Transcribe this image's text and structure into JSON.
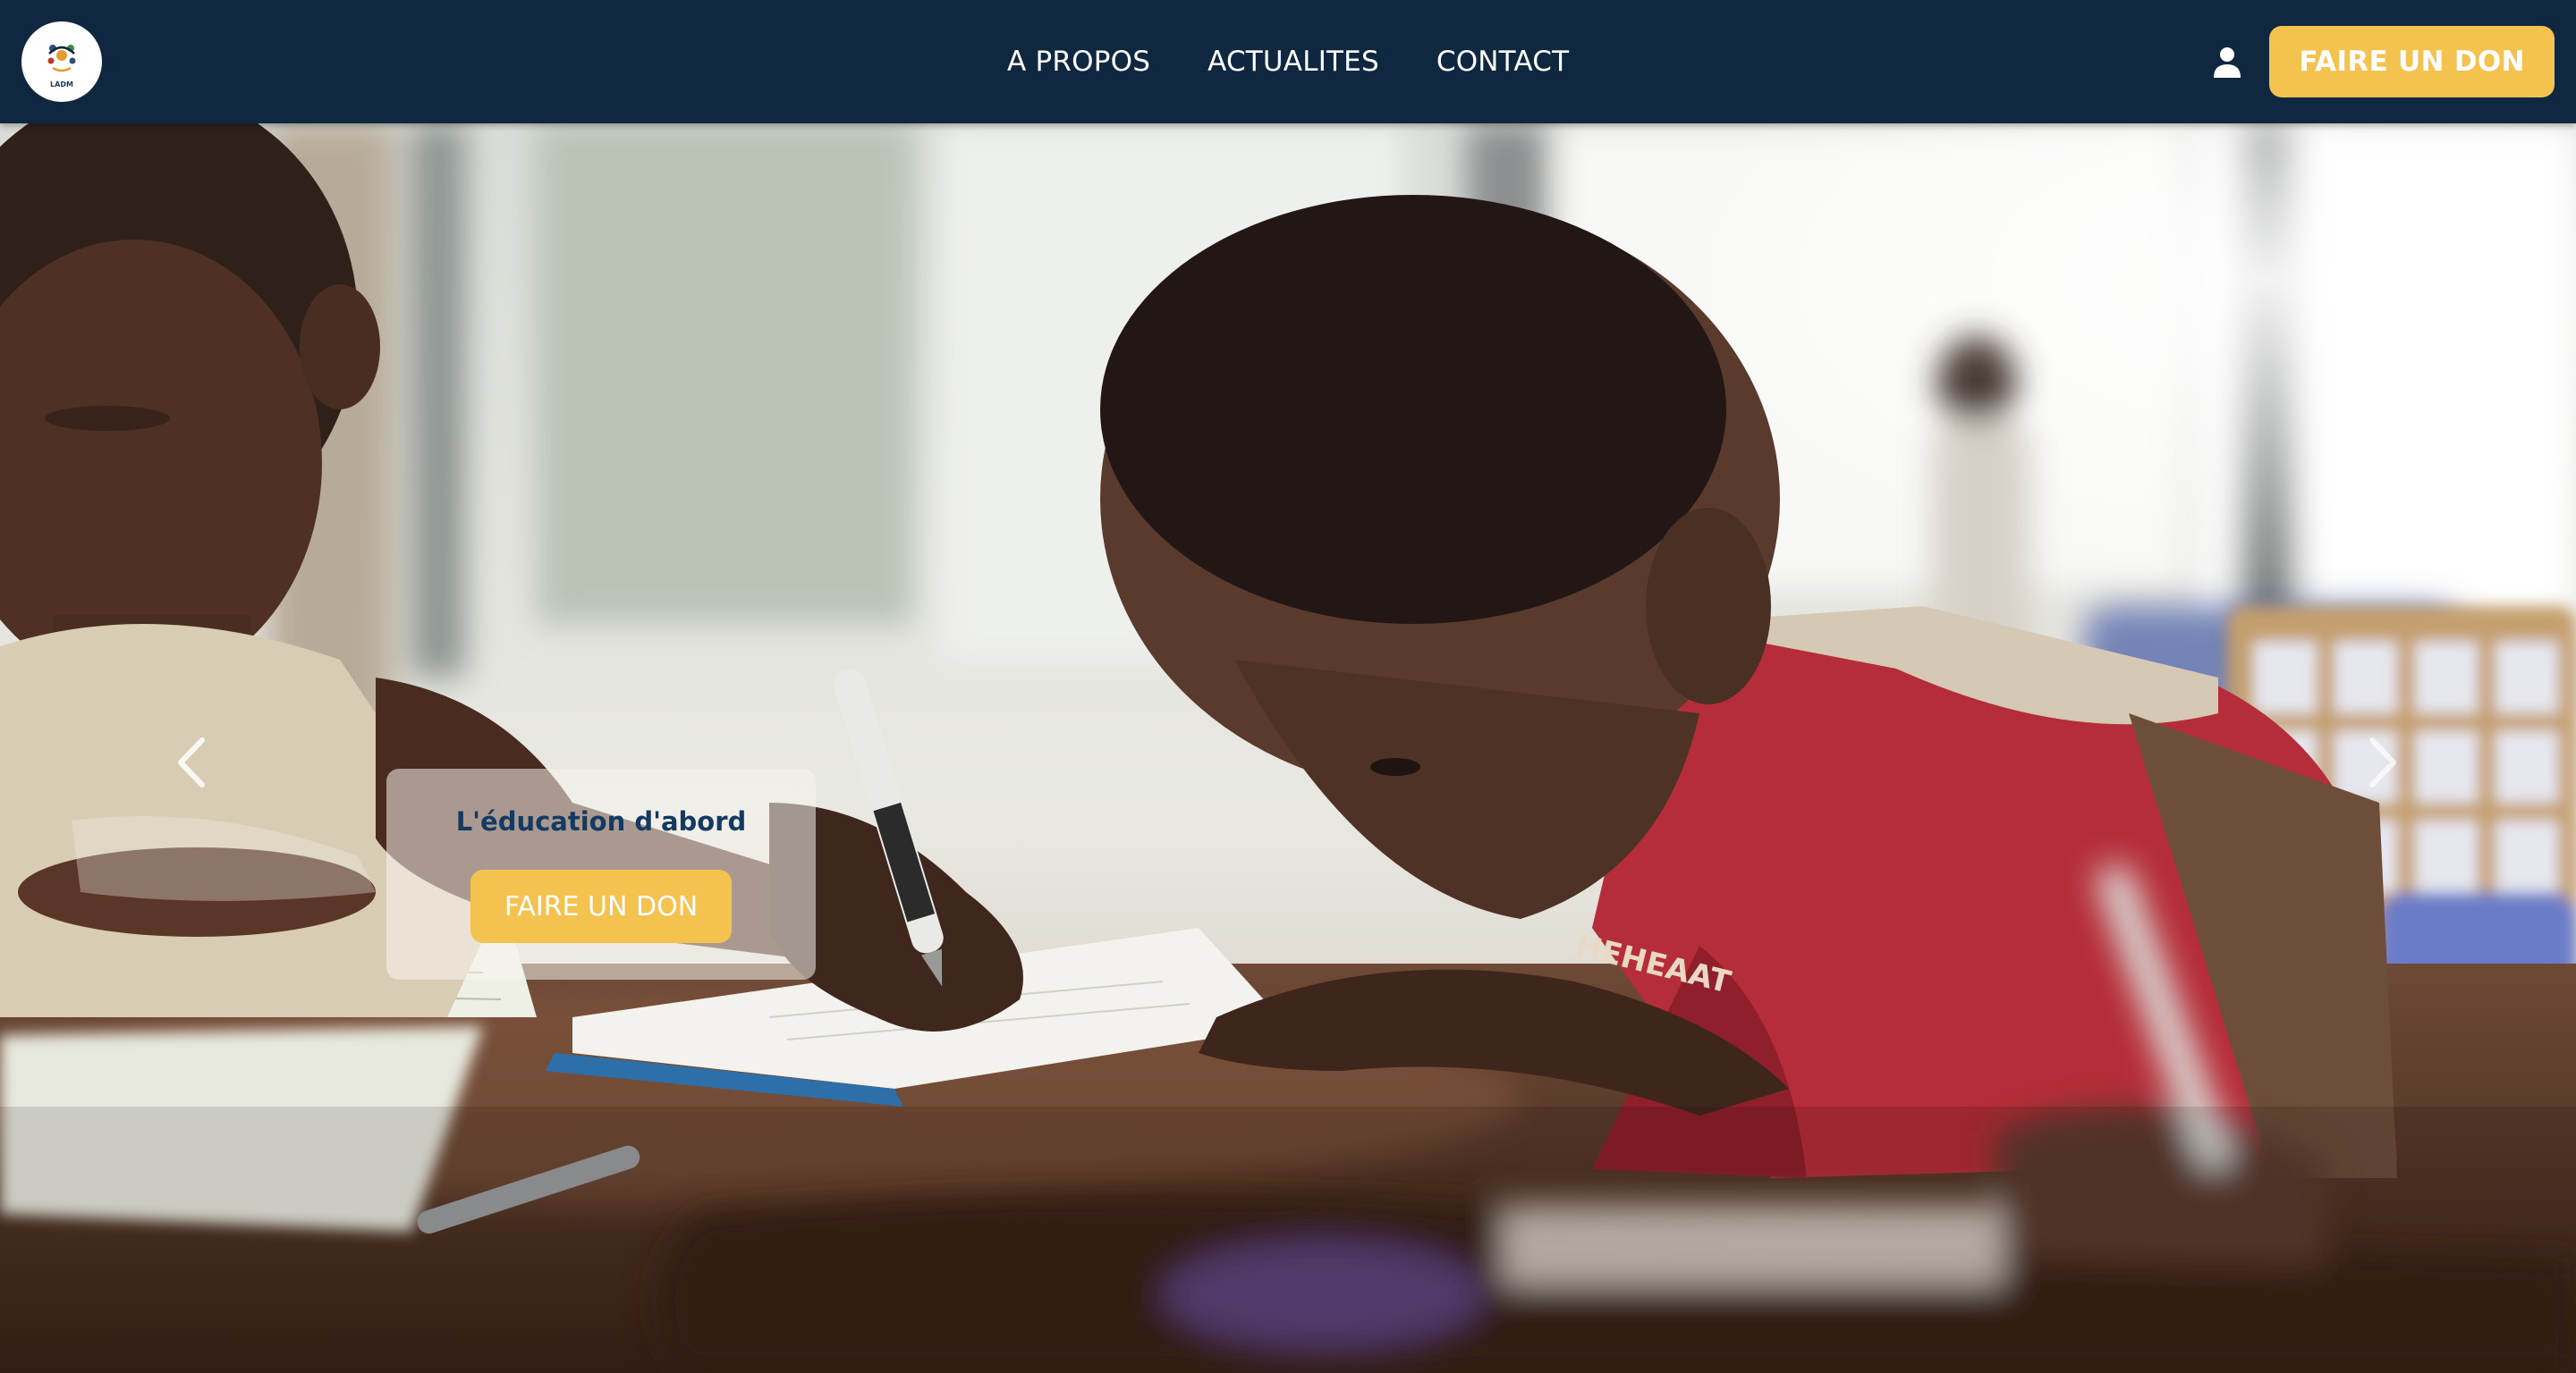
{
  "header": {
    "logo_text": "LADM",
    "nav": [
      {
        "label": "A PROPOS"
      },
      {
        "label": "ACTUALITES"
      },
      {
        "label": "CONTACT"
      }
    ],
    "user_icon": "user-icon",
    "donate_label": "FAIRE UN DON"
  },
  "hero": {
    "caption_title": "L'éducation d'abord",
    "caption_button_label": "FAIRE UN DON",
    "prev_icon": "chevron-left-icon",
    "next_icon": "chevron-right-icon",
    "shirt_text": "HEHEAAT"
  },
  "colors": {
    "header_bg": "#10283f",
    "accent": "#f4c24f",
    "caption_title": "#123a63"
  }
}
